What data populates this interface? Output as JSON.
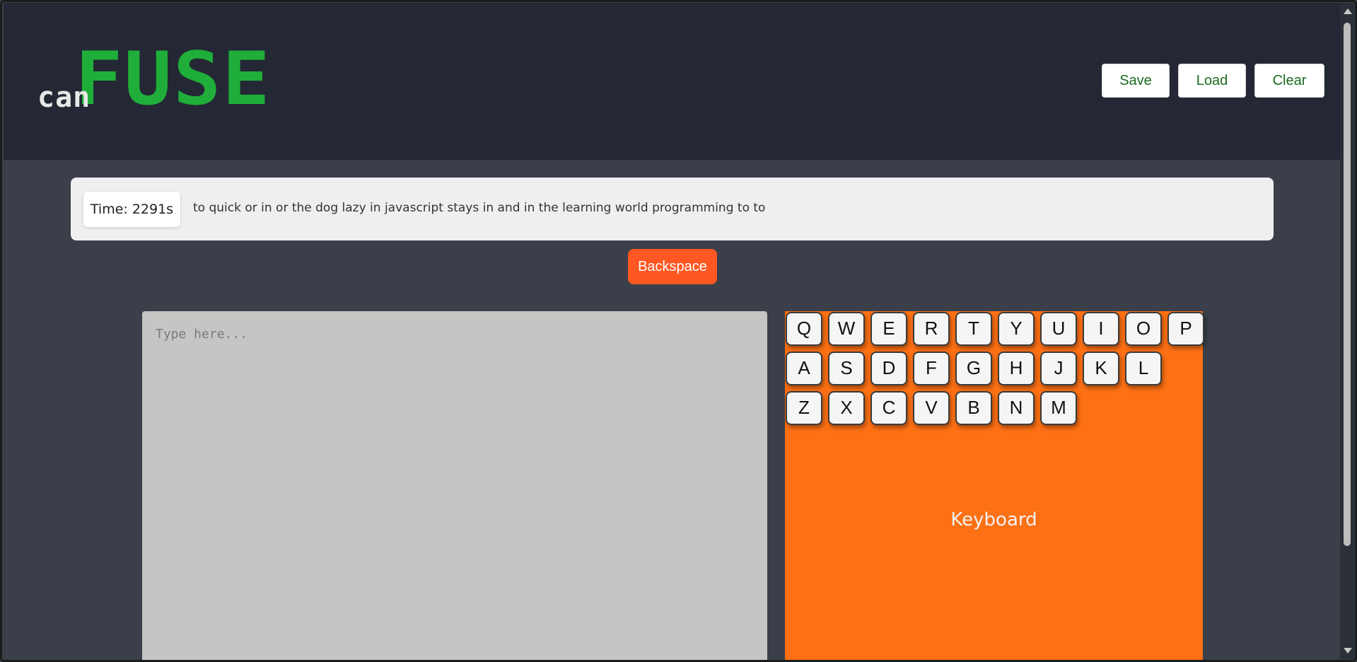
{
  "header": {
    "logo": {
      "prefix": "can",
      "main": "FUSE"
    },
    "buttons": {
      "save": "Save",
      "load": "Load",
      "clear": "Clear"
    }
  },
  "info": {
    "timer": "Time: 2291s",
    "sentence": "to quick or in or the dog lazy in javascript stays in and in the learning world programming to to"
  },
  "actions": {
    "backspace": "Backspace"
  },
  "editor": {
    "placeholder": "Type here...",
    "value": ""
  },
  "keyboard": {
    "label": "Keyboard",
    "rows": [
      [
        "Q",
        "W",
        "E",
        "R",
        "T",
        "Y",
        "U",
        "I",
        "O",
        "P"
      ],
      [
        "A",
        "S",
        "D",
        "F",
        "G",
        "H",
        "J",
        "K",
        "L"
      ],
      [
        "Z",
        "X",
        "C",
        "V",
        "B",
        "N",
        "M"
      ]
    ]
  },
  "colors": {
    "header_bg": "#232834",
    "page_bg": "#3a3f4a",
    "logo_green": "#1fae3a",
    "accent_orange": "#ff5722",
    "keyboard_bg": "#fd7014",
    "button_text": "#1b6b1f"
  }
}
